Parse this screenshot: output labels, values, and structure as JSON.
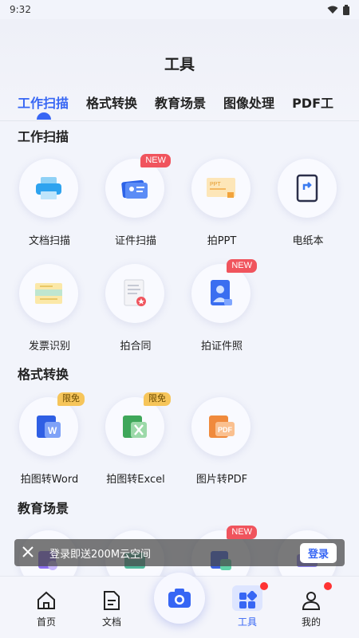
{
  "status": {
    "time": "9:32"
  },
  "header": {
    "title": "工具"
  },
  "tabs": [
    "工作扫描",
    "格式转换",
    "教育场景",
    "图像处理",
    "PDF工"
  ],
  "sections": {
    "work": "工作扫描",
    "format": "格式转换",
    "edu": "教育场景"
  },
  "tools": {
    "doc_scan": {
      "label": "文档扫描",
      "icon": "printer-scan-icon"
    },
    "id_scan": {
      "label": "证件扫描",
      "icon": "id-card-icon",
      "badge": "NEW"
    },
    "ppt": {
      "label": "拍PPT",
      "icon": "ppt-icon"
    },
    "e_paper": {
      "label": "电纸本",
      "icon": "e-notebook-icon"
    },
    "invoice": {
      "label": "发票识别",
      "icon": "invoice-icon"
    },
    "contract": {
      "label": "拍合同",
      "icon": "contract-icon"
    },
    "id_photo": {
      "label": "拍证件照",
      "icon": "id-photo-icon",
      "badge": "NEW"
    },
    "to_word": {
      "label": "拍图转Word",
      "icon": "word-icon",
      "badge": "限免"
    },
    "to_excel": {
      "label": "拍图转Excel",
      "icon": "excel-icon",
      "badge": "限免"
    },
    "to_pdf": {
      "label": "图片转PDF",
      "icon": "pdf-icon"
    },
    "edu3_badge": "NEW"
  },
  "toast": {
    "text": "登录即送200M云空间",
    "button": "登录"
  },
  "nav": {
    "home": "首页",
    "docs": "文档",
    "tools": "工具",
    "mine": "我的"
  },
  "colors": {
    "accent": "#3766f4",
    "badge_new": "#f0545d",
    "badge_free": "#f6c55a"
  }
}
